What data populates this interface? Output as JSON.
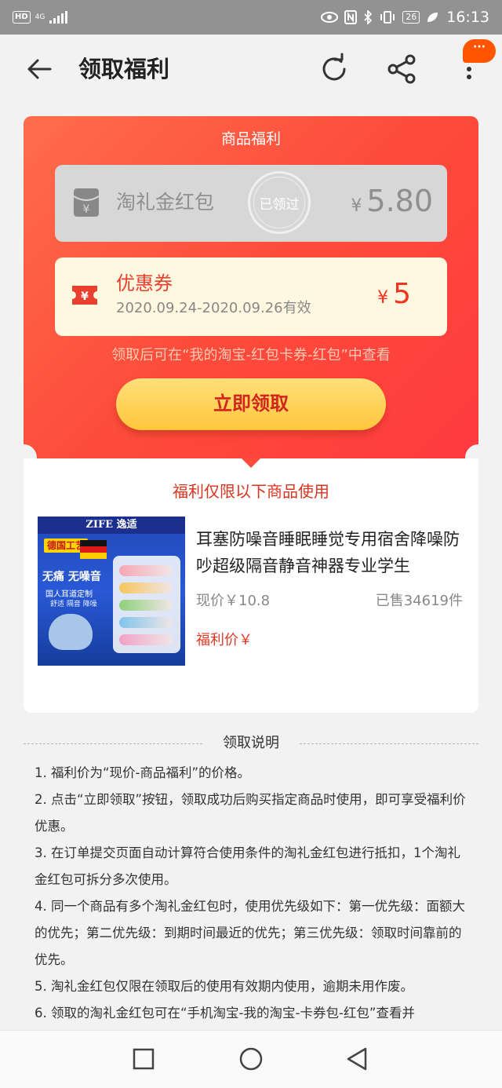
{
  "status_bar": {
    "hd": "HD",
    "network": "4G",
    "battery": "26",
    "time": "16:13"
  },
  "header": {
    "title": "领取福利",
    "badge": "···"
  },
  "benefit_card": {
    "section_title": "商品福利",
    "red_packet": {
      "name": "淘礼金红包",
      "stamp": "已领过",
      "currency": "¥",
      "amount": "5.80"
    },
    "coupon": {
      "name": "优惠券",
      "validity": "2020.09.24-2020.09.26有效",
      "currency": "¥",
      "amount": "5"
    },
    "hint": "领取后可在“我的淘宝-红包卡券-红包”中查看",
    "claim_button": "立即领取"
  },
  "product": {
    "restriction": "福利仅限以下商品使用",
    "image_texts": {
      "brand": "ZIFE 逸适",
      "tag": "德国工艺",
      "slogan": "无痛 无噪音",
      "sub": "国人耳道定制",
      "sub2": "舒适 隔音 降噪"
    },
    "title": "耳塞防噪音睡眠睡觉专用宿舍降噪防吵超级隔音静音神器专业学生",
    "current_price": "现价￥10.8",
    "sold": "已售34619件",
    "welfare_price": "福利价￥"
  },
  "instructions": {
    "heading": "领取说明",
    "items": [
      "1. 福利价为“现价-商品福利”的价格。",
      "2. 点击“立即领取”按钮，领取成功后购买指定商品时使用，即可享受福利价优惠。",
      "3. 在订单提交页面自动计算符合使用条件的淘礼金红包进行抵扣，1个淘礼金红包可拆分多次使用。",
      "4. 同一个商品有多个淘礼金红包时，使用优先级如下：第一优先级：面额大的优先；第二优先级：到期时间最近的优先；第三优先级：领取时间靠前的优先。",
      "5. 淘礼金红包仅限在领取后的使用有效期内使用，逾期未用作废。",
      "6. 领取的淘礼金红包可在“手机淘宝-我的淘宝-卡券包-红包”查看并"
    ]
  },
  "icons": {
    "back": "arrow-left-icon",
    "refresh": "refresh-icon",
    "share": "share-icon",
    "more": "more-vertical-icon",
    "red_packet": "red-packet-icon",
    "coupon": "coupon-ticket-icon"
  },
  "colors": {
    "accent": "#ff4b3b",
    "button": "#ffc63b",
    "coupon_text": "#e8402e"
  }
}
